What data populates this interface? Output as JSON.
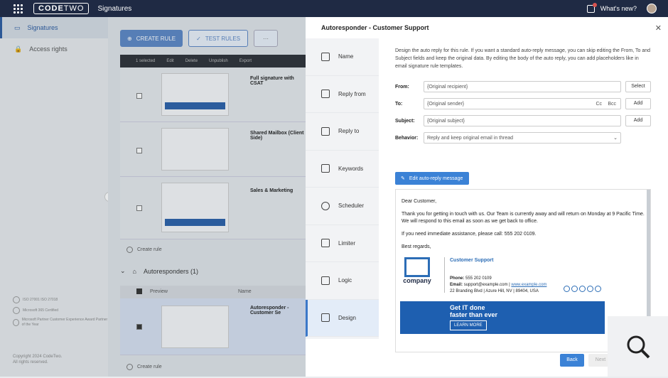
{
  "topbar": {
    "logo_bold": "CODE",
    "logo_light": "TWO",
    "app_name": "Signatures",
    "whats_new": "What's new?"
  },
  "sidebar": {
    "items": [
      {
        "label": "Signatures",
        "active": true
      },
      {
        "label": "Access rights",
        "active": false
      }
    ],
    "certs": [
      "ISO 27001 ISO 27018",
      "Microsoft 365 Certified",
      "Microsoft Partner Customer Experience Award Partner of the Year"
    ],
    "copyright": "Copyright 2024 CodeTwo.",
    "rights": "All rights reserved."
  },
  "main": {
    "create_rule": "CREATE RULE",
    "test_rules": "TEST RULES",
    "more": "···",
    "toolbar": {
      "selected": "1 selected",
      "edit": "Edit",
      "delete": "Delete",
      "unpublish": "Unpublish",
      "export": "Export"
    },
    "rows": [
      {
        "title": "Full signature with CSAT"
      },
      {
        "title": "Shared Mailbox (Client Side)"
      },
      {
        "title": "Sales & Marketing"
      }
    ],
    "create_rule_link": "Create rule",
    "autoresponders": "Autoresponders (1)",
    "col_preview": "Preview",
    "col_name": "Name",
    "auto_row": "Autoresponder - Customer Se"
  },
  "panel": {
    "title": "Autoresponder - Customer Support",
    "nav": [
      "Name",
      "Reply from",
      "Reply to",
      "Keywords",
      "Scheduler",
      "Limiter",
      "Logic",
      "Design"
    ],
    "description": "Design the auto reply for this rule. If you want a standard auto-reply message, you can skip editing the From, To and Subject fields and keep the original data. By editing the body of the auto reply, you can add placeholders like in email signature rule templates.",
    "fields": {
      "from_label": "From:",
      "from_value": "{Original recipient}",
      "from_btn": "Select",
      "to_label": "To:",
      "to_value": "{Original sender}",
      "cc": "Cc",
      "bcc": "Bcc",
      "to_btn": "Add",
      "subject_label": "Subject:",
      "subject_value": "{Original subject}",
      "subject_btn": "Add",
      "behavior_label": "Behavior:",
      "behavior_value": "Reply and keep original email in thread"
    },
    "edit_button": "Edit auto-reply message",
    "message": {
      "greeting": "Dear Customer,",
      "body1": "Thank you for getting in touch with us. Our Team is currently away and will return on Monday at 9 Pacific Time. We will respond to this email as soon as we get back to office.",
      "body2": "If you need immediate assistance, please call: 555 202 0109.",
      "closing": "Best regards,"
    },
    "signature": {
      "brand": "company",
      "name": "Customer Support",
      "phone_label": "Phone:",
      "phone": "555 202 0109",
      "email_label": "Email:",
      "email": "support@example.com",
      "web": "www.example.com",
      "address": "22 Branding Blvd | Azure Hill, NV | 89404, USA",
      "banner_line1": "Get IT done",
      "banner_line2": "faster than ever",
      "banner_cta": "LEARN MORE"
    },
    "back": "Back",
    "next": "Next"
  }
}
